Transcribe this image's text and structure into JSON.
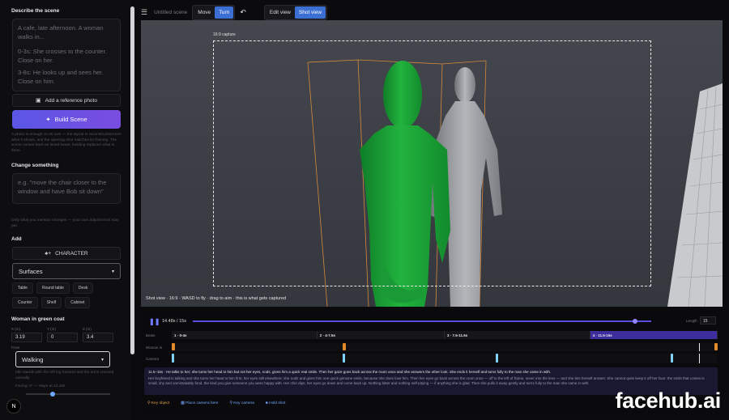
{
  "sidebar": {
    "describe_title": "Describe the scene",
    "scene_text": [
      "A cafe, late afternoon. A woman walks in...",
      "0-3s: She crosses to the counter. Close on her.",
      "3-8s: He looks up and sees her. Close on him."
    ],
    "reference_label": "Add a reference photo",
    "build_label": "Build Scene",
    "build_note": "A photo is enough on its own — the layout is reconstructed from what it shows, and the opening shot matches its framing. The scene comes back as timed beats; building replaces what is there.",
    "change_title": "Change something",
    "change_placeholder": "e.g. \"move the chair closer to the window and have Bob sit down\"",
    "change_note": "Only what you mention changes — your own adjustments stay put.",
    "add_title": "Add",
    "character_label": "CHARACTER",
    "surfaces_label": "Surfaces",
    "surfaces": [
      "Table",
      "Round table",
      "Desk",
      "Counter",
      "Shelf",
      "Cabinet"
    ],
    "object_title": "Woman in green coat",
    "x_label": "X (m)",
    "x_value": "3.19",
    "y_label": "Y (m)",
    "y_value": "0",
    "z_label": "Z (m)",
    "z_value": "3.4",
    "pose_label": "Pose",
    "pose_value": "Walking",
    "pose_note": "Idle stands with the left leg forward and the arms crossed casually.",
    "facing_label": "Facing: 0°",
    "facing_value": "— stays at 14.48s",
    "facing_fraction": 0.32
  },
  "topbar": {
    "scene_name": "Untitled scene",
    "move_label": "Move",
    "turn_label": "Turn",
    "edit_view_label": "Edit view",
    "shot_view_label": "Shot view"
  },
  "viewport": {
    "capture_label": "16:9 capture",
    "hint": "Shot view · 16:9 · WASD to fly · drag to aim · this is what gets captured"
  },
  "timeline": {
    "time": "14.48s / 15s",
    "progress": 0.965,
    "length_label": "Length",
    "length_value": "15",
    "row_beats": "Beats",
    "row_woman": "Woman in",
    "row_camera": "Camera",
    "beats": [
      {
        "label": "1 · 0-4s",
        "start": 0,
        "end": 4
      },
      {
        "label": "2 · 4-7.5s",
        "start": 4,
        "end": 7.5
      },
      {
        "label": "3 · 7.5-11.5s",
        "start": 7.5,
        "end": 11.5
      },
      {
        "label": "4 · 11.5-15s",
        "start": 11.5,
        "end": 15
      }
    ],
    "woman_keys": [
      0,
      4.7,
      15
    ],
    "camera_keys": [
      0,
      4.7,
      8.9,
      13.7
    ],
    "playhead": 14.48,
    "desc_head": "11.5–15s · He talks to her; she turns her head to him but not her eyes, nods, gives him a quick real smile. Then her gaze goes back across the room once and she answers the other look. She ends it herself and turns fully to the man she came in with.",
    "desc_body": "Her boyfriend is talking and she turns her head to him first, her eyes still elsewhere; she nods and gives him one quick genuine smile, because she does love him. Then her eyes go back across the room once — off to the left of frame, never into the lens — and she lets herself answer. She cannot quite keep it off her face: the smile that comes is small, shy and unmistakably fond, the kind you give someone you were happy with. Her chin dips, her eyes go down and come back up. Nothing bitter and nothing self-pitying — if anything she is glad. Then she pulls it away gently and turns fully to the man she came in with.",
    "legend": [
      "Key object",
      "Place camera here",
      "Key camera",
      "Hold shot"
    ]
  },
  "brand": "facehub.ai",
  "badge": "N",
  "colors": {
    "accent": "#3b6fd4",
    "build": "#6a52e4",
    "beat_active": "#3d2e9e",
    "woman_key": "#e08a2a",
    "camera_key": "#7fd4ff",
    "figure_green": "#1fa83a"
  }
}
